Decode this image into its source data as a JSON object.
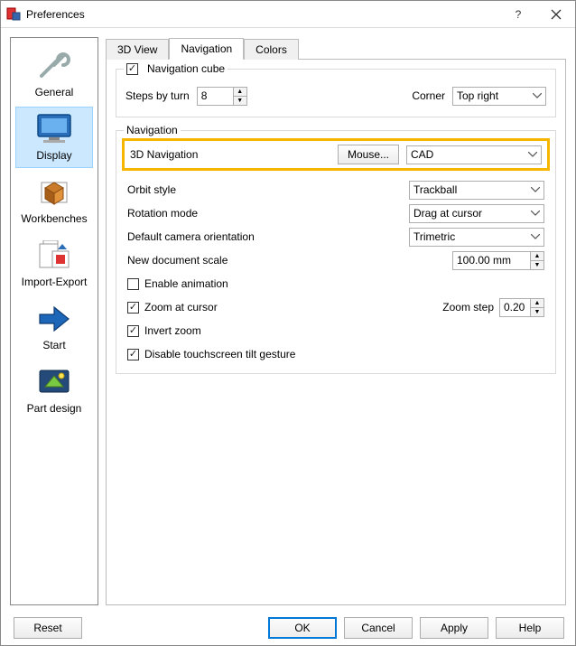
{
  "window": {
    "title": "Preferences"
  },
  "sidebar": {
    "items": [
      {
        "label": "General"
      },
      {
        "label": "Display"
      },
      {
        "label": "Workbenches"
      },
      {
        "label": "Import-Export"
      },
      {
        "label": "Start"
      },
      {
        "label": "Part design"
      }
    ],
    "selected_index": 1
  },
  "tabs": {
    "items": [
      "3D View",
      "Navigation",
      "Colors"
    ],
    "active_index": 1
  },
  "navcube": {
    "legend": "Navigation cube",
    "enabled": true,
    "steps_label": "Steps by turn",
    "steps_value": "8",
    "corner_label": "Corner",
    "corner_value": "Top right"
  },
  "nav": {
    "legend": "Navigation",
    "threeD_label": "3D Navigation",
    "mouse_button": "Mouse...",
    "style_value": "CAD",
    "orbit_label": "Orbit style",
    "orbit_value": "Trackball",
    "rotation_label": "Rotation mode",
    "rotation_value": "Drag at cursor",
    "camera_label": "Default camera orientation",
    "camera_value": "Trimetric",
    "scale_label": "New document scale",
    "scale_value": "100.00 mm",
    "enable_anim_label": "Enable animation",
    "enable_anim": false,
    "zoom_cursor_label": "Zoom at cursor",
    "zoom_cursor": true,
    "zoom_step_label": "Zoom step",
    "zoom_step_value": "0.20",
    "invert_zoom_label": "Invert zoom",
    "invert_zoom": true,
    "tilt_label": "Disable touchscreen tilt gesture",
    "tilt": true
  },
  "buttons": {
    "reset": "Reset",
    "ok": "OK",
    "cancel": "Cancel",
    "apply": "Apply",
    "help": "Help"
  }
}
